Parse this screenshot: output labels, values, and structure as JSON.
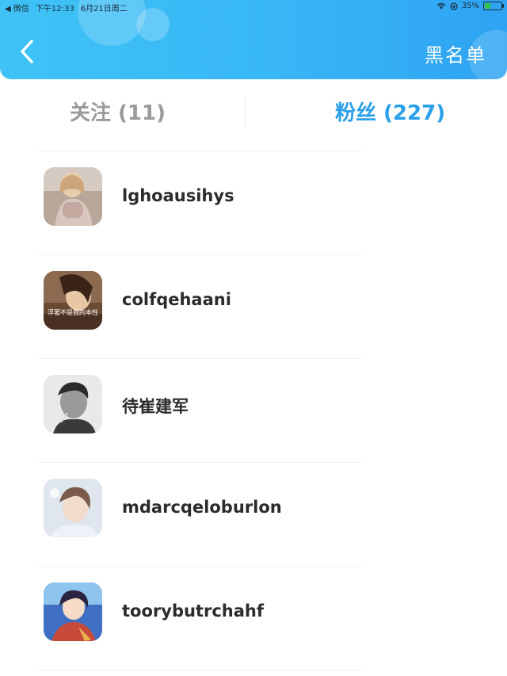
{
  "status_bar": {
    "carrier": "◀ 微信",
    "time": "下午12:33",
    "date": "6月21日周二",
    "battery": "35%",
    "battery_level": 0.35
  },
  "header": {
    "back_icon": "chevron-left-icon",
    "right_action": "黑名单",
    "gradient": [
      "#3fc3f6",
      "#2ea3f2"
    ]
  },
  "tabs": [
    {
      "label": "关注 (11)",
      "active": false
    },
    {
      "label": "粉丝 (227)",
      "active": true
    }
  ],
  "colors": {
    "active_tab": "#2aa0ea",
    "inactive_tab": "#9a9a9a",
    "name": "#2b2b2b"
  },
  "users": [
    {
      "name": "lghoausihys"
    },
    {
      "name": "colfqehaani",
      "avatar_caption": "浮著不是我的本性"
    },
    {
      "name": "待崔建军"
    },
    {
      "name": "mdarcqeloburlon"
    },
    {
      "name": "toorybutrchahf"
    }
  ]
}
